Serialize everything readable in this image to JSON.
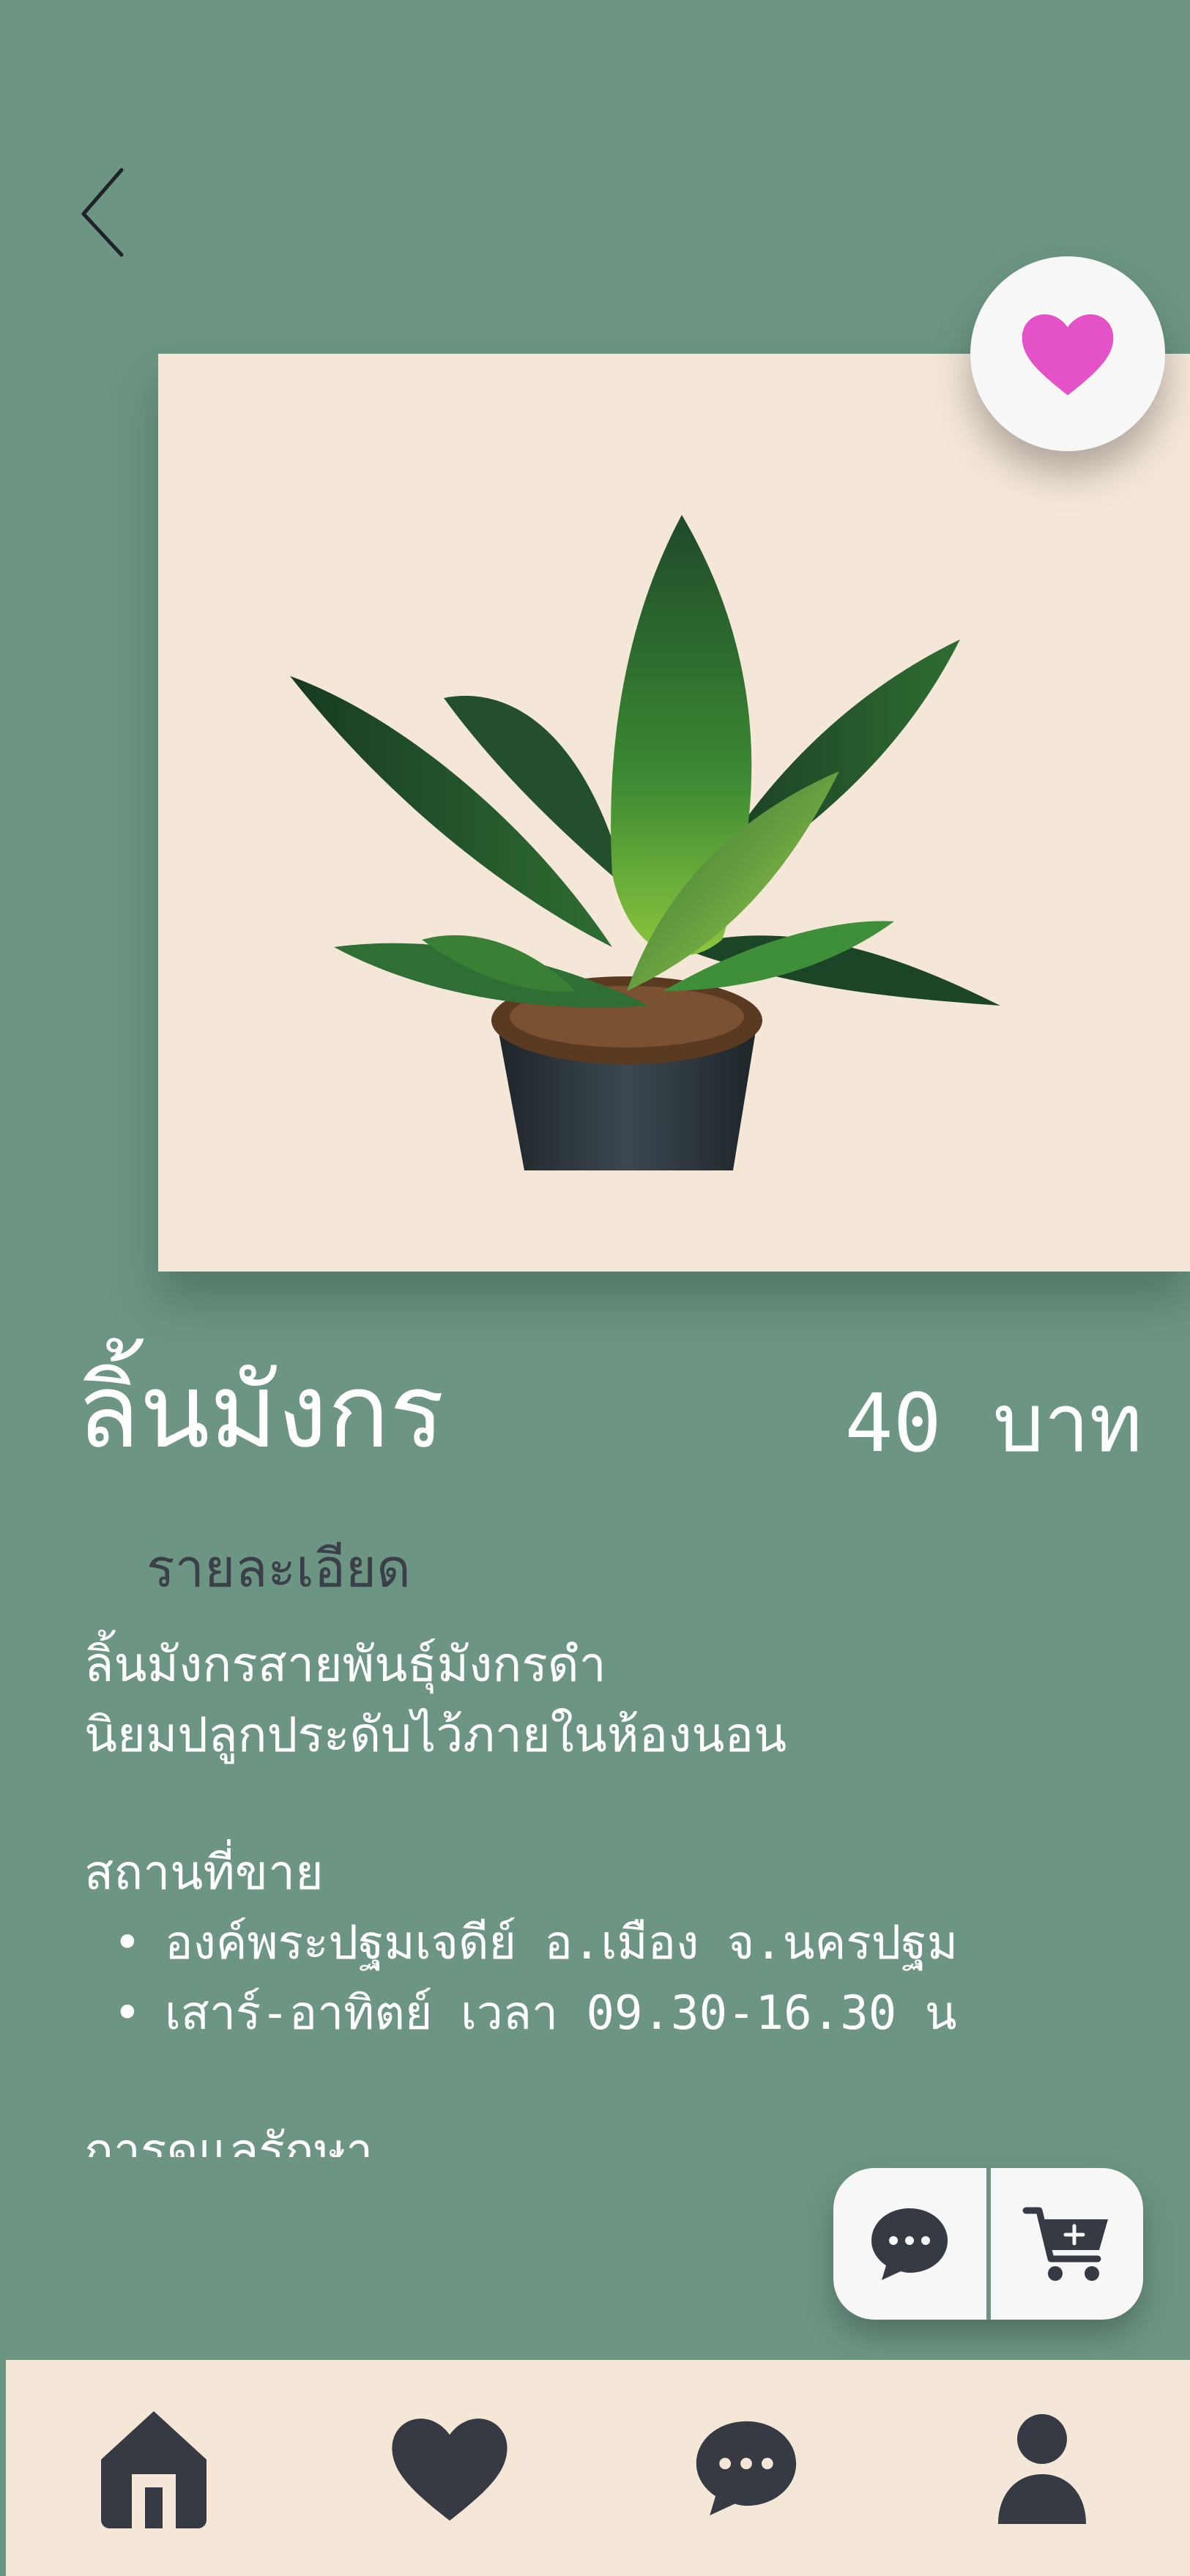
{
  "product": {
    "name": "ลิ้นมังกร",
    "price_value": "40",
    "price_unit": "บาท"
  },
  "details": {
    "heading": "รายละเอียด",
    "description_lines": [
      "ลิ้นมังกรสายพันธุ์มังกรดำ",
      "นิยมปลูกประดับไว้ภายในห้องนอน"
    ],
    "location_heading": "สถานที่ขาย",
    "location_bullets": [
      "องค์พระปฐมเจดีย์ อ.เมือง จ.นครปฐม",
      "เสาร์-อาทิตย์ เวลา 09.30-16.30 น"
    ],
    "care_heading": "การดูแลรักษา"
  },
  "icons": {
    "back": "chevron-left-icon",
    "favorite": "heart-icon",
    "chat": "chat-bubble-icon",
    "cart": "cart-plus-icon",
    "nav_home": "home-icon",
    "nav_favorites": "heart-icon",
    "nav_chat": "chat-bubble-icon",
    "nav_profile": "user-icon"
  },
  "colors": {
    "background": "#6c9683",
    "card": "#f4e7d8",
    "favorite_accent": "#e352c6",
    "icon_dark": "#363a43",
    "white": "#ffffff"
  }
}
